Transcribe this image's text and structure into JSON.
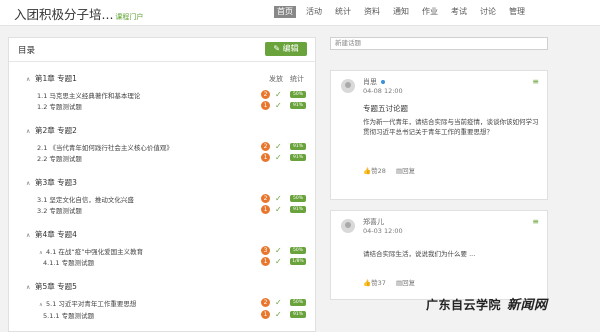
{
  "header": {
    "course_title": "入团积极分子培...",
    "portal_link": "课程门户",
    "nav": [
      "首页",
      "活动",
      "统计",
      "资料",
      "通知",
      "作业",
      "考试",
      "讨论",
      "管理"
    ],
    "active_nav": "首页"
  },
  "left_panel": {
    "title": "目录",
    "edit_label": "编辑",
    "col_publish": "发放",
    "col_stats": "统计",
    "chapters": [
      {
        "label": "第1章 专题1",
        "sections": [
          {
            "label": "1.1 马克思主义经典著作和基本理论",
            "badge": "2",
            "stat": "50%"
          },
          {
            "label": "1.2 专题测试题",
            "badge": "1",
            "stat": "91%"
          }
        ]
      },
      {
        "label": "第2章 专题2",
        "sections": [
          {
            "label": "2.1 《当代青年如何践行社会主义核心价值观》",
            "badge": "2",
            "stat": "91%"
          },
          {
            "label": "2.2 专题测试题",
            "badge": "1",
            "stat": "91%"
          }
        ]
      },
      {
        "label": "第3章 专题3",
        "sections": [
          {
            "label": "3.1 坚定文化自信，推动文化兴盛",
            "badge": "2",
            "stat": "50%"
          },
          {
            "label": "3.2 专题测试题",
            "badge": "1",
            "stat": "91%"
          }
        ]
      },
      {
        "label": "第4章 专题4",
        "sections": [
          {
            "label": "4.1 在战“疫”中强化爱国主义教育",
            "badge": "3",
            "stat": "50%"
          },
          {
            "label": "4.1.1 专题测试题",
            "badge": "1",
            "stat": "1/8%"
          }
        ]
      },
      {
        "label": "第5章 专题5",
        "sections": [
          {
            "label": "5.1 习近平对青年工作重要思想",
            "badge": "2",
            "stat": "50%"
          },
          {
            "label": "5.1.1 专题测试题",
            "badge": "1",
            "stat": "91%"
          }
        ]
      }
    ]
  },
  "right_panel": {
    "search_placeholder": "新建话题",
    "posts": [
      {
        "author": "肖思",
        "time": "04-08 12:00",
        "title": "专题五讨论题",
        "body": "作为新一代青年，请结合实际与当前疫情，谈谈你该如何学习贯彻习近平总书记关于青年工作的重要思想？",
        "likes": "赞28",
        "reply": "回复"
      },
      {
        "author": "郑喜儿",
        "time": "04-03 12:00",
        "title": "",
        "body": "请结合实际生活，说说我们为什么要 ...",
        "likes": "赞37",
        "reply": "回复"
      }
    ]
  },
  "watermark": {
    "left": "广东自云学院",
    "right": "新闻网"
  },
  "colors": {
    "accent": "#6aa33c",
    "badge": "#e8762c",
    "online": "#3a8fd9"
  }
}
